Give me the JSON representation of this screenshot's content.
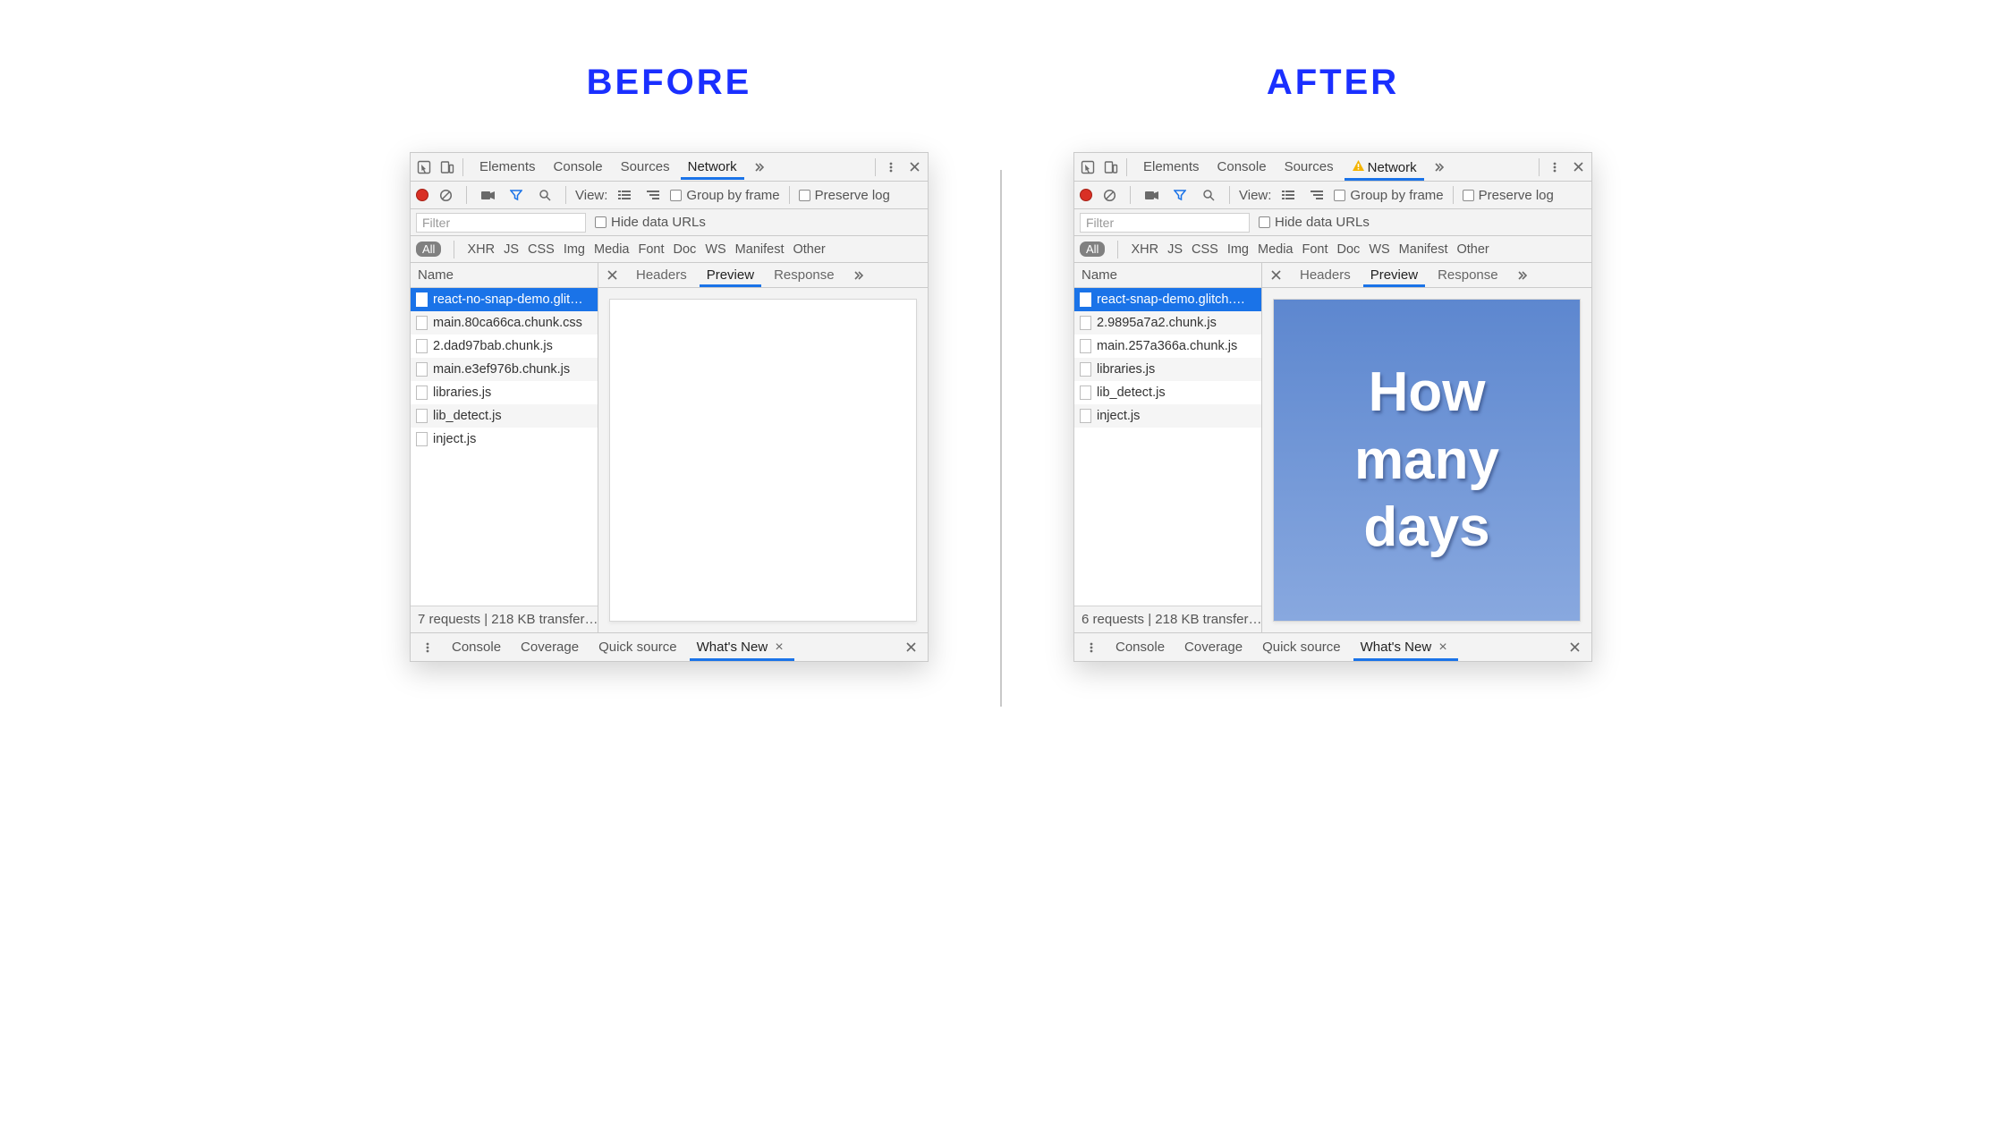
{
  "titles": {
    "before": "BEFORE",
    "after": "AFTER"
  },
  "tabs": {
    "elements": "Elements",
    "console": "Console",
    "sources": "Sources",
    "network": "Network"
  },
  "toolbar": {
    "view": "View:",
    "group": "Group by frame",
    "preserve": "Preserve log"
  },
  "filter": {
    "placeholder": "Filter",
    "hide": "Hide data URLs"
  },
  "types": {
    "all": "All",
    "xhr": "XHR",
    "js": "JS",
    "css": "CSS",
    "img": "Img",
    "media": "Media",
    "font": "Font",
    "doc": "Doc",
    "ws": "WS",
    "manifest": "Manifest",
    "other": "Other"
  },
  "list": {
    "name": "Name"
  },
  "ptabs": {
    "headers": "Headers",
    "preview": "Preview",
    "response": "Response"
  },
  "drawer": {
    "console": "Console",
    "coverage": "Coverage",
    "quick": "Quick source",
    "whats": "What's New"
  },
  "before": {
    "requests": [
      "react-no-snap-demo.glit…",
      "main.80ca66ca.chunk.css",
      "2.dad97bab.chunk.js",
      "main.e3ef976b.chunk.js",
      "libraries.js",
      "lib_detect.js",
      "inject.js"
    ],
    "footer": "7 requests | 218 KB transfer…",
    "warn": false,
    "preview_words": []
  },
  "after": {
    "requests": [
      "react-snap-demo.glitch.…",
      "2.9895a7a2.chunk.js",
      "main.257a366a.chunk.js",
      "libraries.js",
      "lib_detect.js",
      "inject.js"
    ],
    "footer": "6 requests | 218 KB transfer…",
    "warn": true,
    "preview_words": [
      "How",
      "many",
      "days"
    ]
  }
}
